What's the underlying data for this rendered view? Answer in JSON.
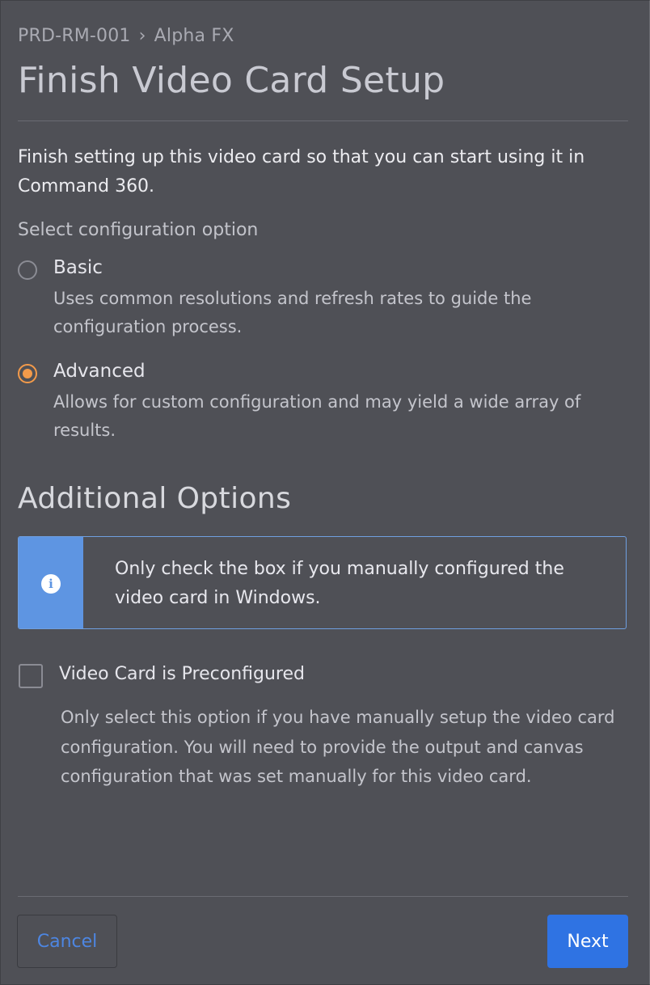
{
  "breadcrumb": {
    "device": "PRD-RM-001",
    "separator": "›",
    "card": "Alpha FX"
  },
  "title": "Finish Video Card Setup",
  "intro": "Finish setting up this video card so that you can start using it in Command 360.",
  "config": {
    "label": "Select configuration option",
    "options": [
      {
        "title": "Basic",
        "description": "Uses common resolutions and refresh rates to guide the configuration process.",
        "selected": false
      },
      {
        "title": "Advanced",
        "description": "Allows for custom configuration and may yield a wide array of results.",
        "selected": true
      }
    ],
    "accent_color": "#f39a4a"
  },
  "additional": {
    "heading": "Additional Options",
    "info_message": "Only check the box if you manually configured the video card in Windows.",
    "info_icon": "info-icon",
    "info_color": "#5e95e2",
    "checkbox_label": "Video Card is Preconfigured",
    "checkbox_checked": false,
    "checkbox_description": "Only select this option if you have manually setup the video card configuration. You will need to provide the output and canvas configuration that was set manually for this video card."
  },
  "footer": {
    "cancel_label": "Cancel",
    "next_label": "Next",
    "primary_color": "#2f73e3"
  }
}
